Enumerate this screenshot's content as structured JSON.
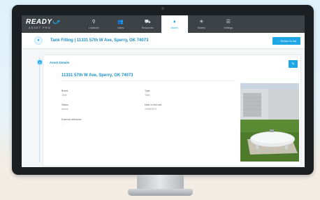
{
  "app": {
    "logo_main": "READY",
    "logo_sub": "ASSET PRO"
  },
  "nav": [
    {
      "label": "Locations",
      "icon": "map-pin-icon",
      "glyph": "⚲"
    },
    {
      "label": "Users",
      "icon": "users-icon",
      "glyph": "👥"
    },
    {
      "label": "Resources",
      "icon": "truck-icon",
      "glyph": "⛟"
    },
    {
      "label": "Assets",
      "icon": "tank-icon",
      "glyph": "♦"
    },
    {
      "label": "Shares",
      "icon": "lightbulb-icon",
      "glyph": "☀"
    },
    {
      "label": "Settings",
      "icon": "sliders-icon",
      "glyph": "☰"
    }
  ],
  "header": {
    "title": "Tank Filling | 11331 57th W Ave, Sperry, OK 74073",
    "return_button": "Return to list"
  },
  "details": {
    "section_title": "Asset Details",
    "address": "11331 57th W Ave, Sperry, OK 74073",
    "fields": {
      "brand_label": "Brand",
      "brand_value": "Tank",
      "type_label": "Type",
      "type_value": "Tank",
      "status_label": "Status",
      "status_value": "Active",
      "date_label": "Date of first use",
      "date_value": "10/08/2021",
      "extref_label": "External reference",
      "extref_value": "-"
    }
  },
  "colors": {
    "accent": "#1ea7e4",
    "nav_bg": "#3d4247"
  }
}
